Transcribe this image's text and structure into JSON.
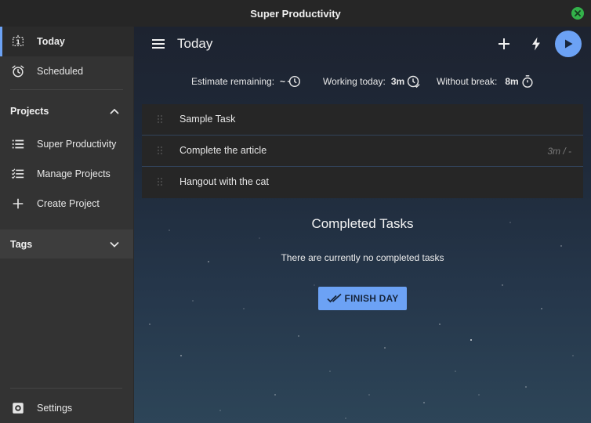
{
  "window": {
    "title": "Super Productivity"
  },
  "sidebar": {
    "nav": [
      {
        "label": "Today",
        "icon": "today-icon",
        "active": true
      },
      {
        "label": "Scheduled",
        "icon": "alarm-clock-icon",
        "active": false
      }
    ],
    "projects": {
      "heading": "Projects",
      "items": [
        {
          "label": "Super Productivity",
          "icon": "list-icon"
        },
        {
          "label": "Manage Projects",
          "icon": "checklist-icon"
        },
        {
          "label": "Create Project",
          "icon": "plus-icon"
        }
      ]
    },
    "tags": {
      "heading": "Tags"
    },
    "settings": {
      "label": "Settings",
      "icon": "gear-icon"
    }
  },
  "main": {
    "title": "Today",
    "stats": {
      "estimate_label": "Estimate remaining:",
      "estimate_value": "~",
      "working_label": "Working today:",
      "working_value": "3m",
      "break_label": "Without break:",
      "break_value": "8m"
    },
    "tasks": [
      {
        "title": "Sample Task",
        "time": ""
      },
      {
        "title": "Complete the article",
        "time": "3m / -"
      },
      {
        "title": "Hangout with the cat",
        "time": ""
      }
    ],
    "completed": {
      "heading": "Completed Tasks",
      "empty_text": "There are currently no completed tasks",
      "finish_label": "FINISH DAY"
    }
  },
  "colors": {
    "accent": "#6ca2f5",
    "sidebar_bg": "#333333",
    "task_bg": "#262626",
    "close_button": "#33b14a"
  }
}
